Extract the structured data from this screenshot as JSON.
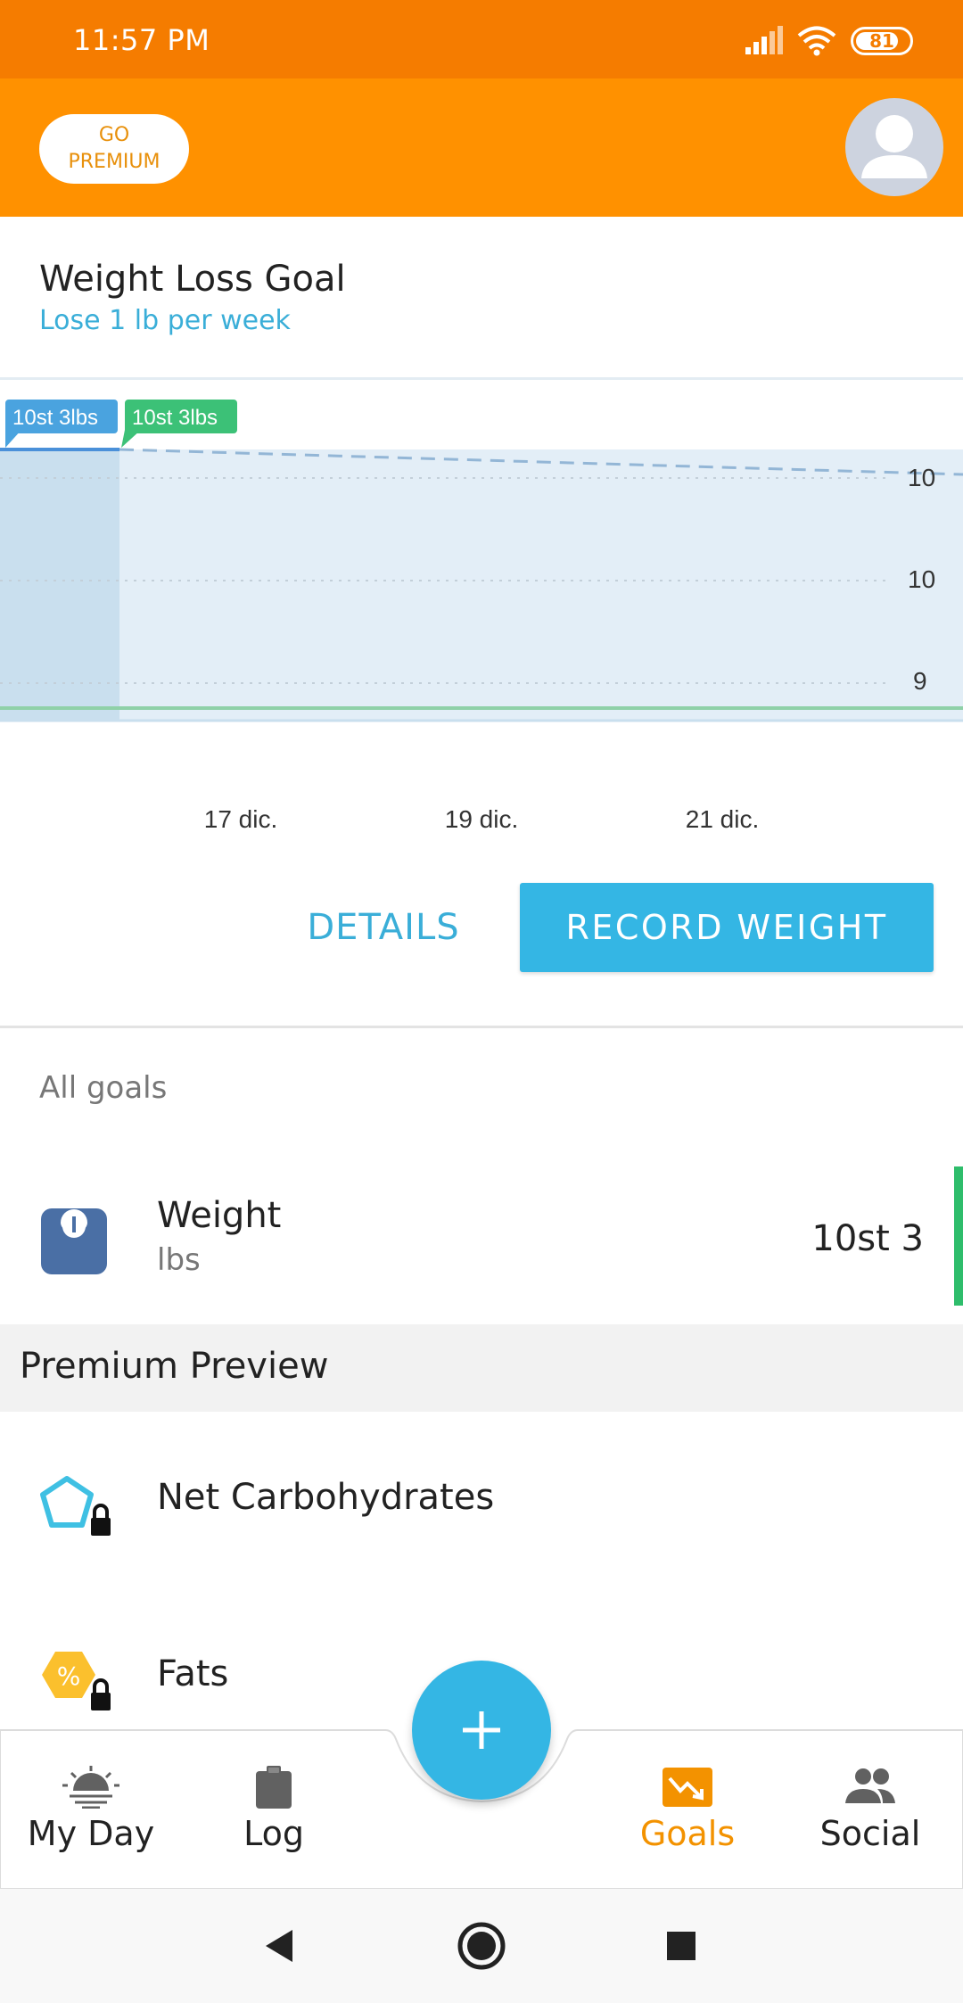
{
  "status_bar": {
    "time": "11:57 PM",
    "battery": "81",
    "battery_level": 0.81
  },
  "header": {
    "premium_line1": "GO",
    "premium_line2": "PREMIUM"
  },
  "goal": {
    "title": "Weight Loss Goal",
    "subtitle": "Lose 1 lb per week"
  },
  "chart_data": {
    "type": "line",
    "tags": [
      "10st 3lbs",
      "10st 3lbs"
    ],
    "y_tick_labels": [
      "10",
      "10",
      "9"
    ],
    "x_tick_labels": [
      "17 dic.",
      "19 dic.",
      "21 dic."
    ],
    "grid": true,
    "colors": {
      "current": "#4a90d9",
      "goal": "#2ebd6b",
      "area": "#e3eef7",
      "past_area": "#c9dfee"
    }
  },
  "buttons": {
    "details": "DETAILS",
    "record_weight": "RECORD WEIGHT"
  },
  "all_goals_label": "All goals",
  "weight_goal": {
    "label": "Weight",
    "unit": "lbs",
    "value": "10st 3"
  },
  "premium_preview": {
    "title": "Premium Preview",
    "items": [
      {
        "label": "Net Carbohydrates",
        "icon": "pentagon-lock-icon"
      },
      {
        "label": "Fats",
        "icon": "percent-lock-icon"
      }
    ]
  },
  "nav": {
    "items": [
      {
        "label": "My Day",
        "icon": "sunrise-icon"
      },
      {
        "label": "Log",
        "icon": "clipboard-icon"
      },
      {
        "label": "Goals",
        "icon": "trend-down-icon",
        "active": true
      },
      {
        "label": "Social",
        "icon": "people-icon"
      }
    ]
  },
  "colors": {
    "accent": "#34b6e4",
    "brand_orange": "#ff9100",
    "status_orange": "#f57c00",
    "goals_active": "#f39200"
  }
}
